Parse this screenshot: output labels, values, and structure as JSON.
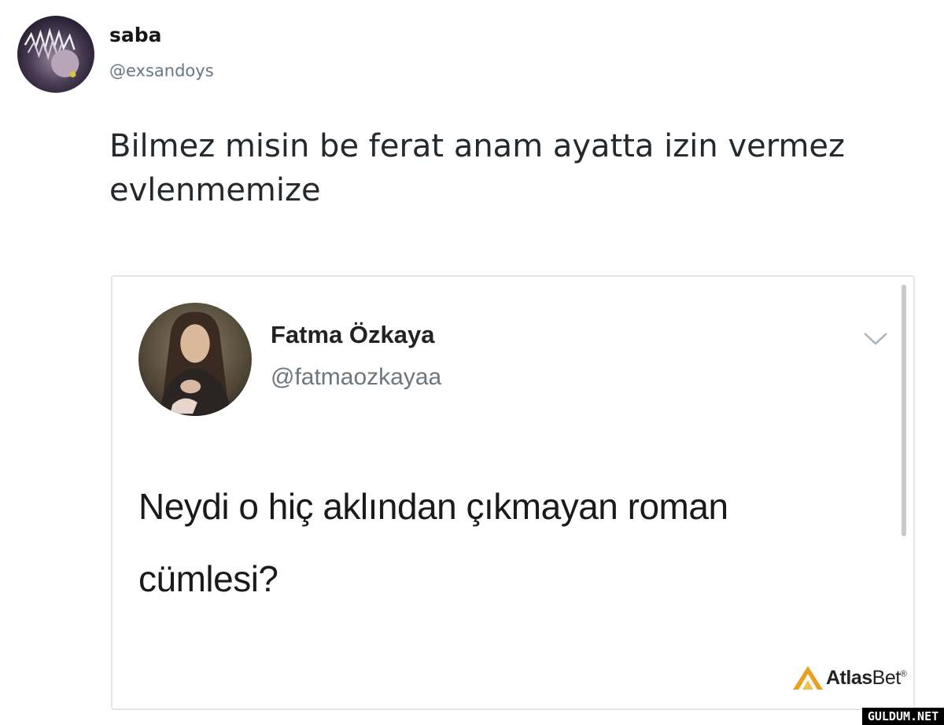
{
  "tweet": {
    "author_name": "saba",
    "author_handle": "@exsandoys",
    "text": "Bilmez misin be ferat anam ayatta izin vermez evlenmemize"
  },
  "quoted_tweet": {
    "author_name": "Fatma Özkaya",
    "author_handle": "@fatmaozkayaa",
    "text": "Neydi o hiç aklından çıkmayan roman cümlesi?"
  },
  "logo": {
    "brand_bold": "Atlas",
    "brand_light": "Bet",
    "registered": "®",
    "color": "#e8a020"
  },
  "watermark": "GULDUM.NET",
  "icons": {
    "expand": "chevron-down-icon"
  }
}
